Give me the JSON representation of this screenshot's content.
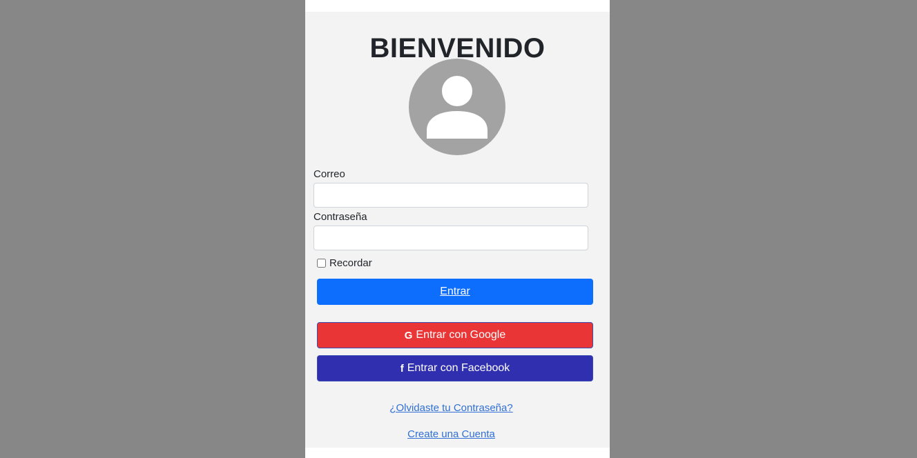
{
  "login": {
    "title": "BIENVENIDO",
    "avatar_icon": "user-avatar-icon",
    "email_label": "Correo",
    "email_value": "",
    "password_label": "Contraseña",
    "password_value": "",
    "remember_label": "Recordar",
    "remember_checked": false,
    "submit_label": "Entrar",
    "google_icon": "G",
    "google_label": "Entrar con Google",
    "facebook_icon": "f",
    "facebook_label": "Entrar con Facebook",
    "forgot_link": "¿Olvidaste tu Contraseña?",
    "create_link": "Create una Cuenta"
  },
  "colors": {
    "background": "#878787",
    "card": "#f3f3f3",
    "primary": "#0d6efd",
    "google": "#e93535",
    "facebook": "#2f2fb0",
    "link": "#2f6fd6"
  }
}
